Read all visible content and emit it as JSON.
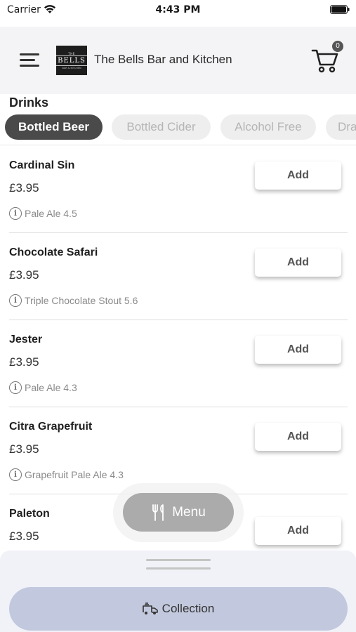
{
  "status_bar": {
    "carrier": "Carrier",
    "time": "4:43 PM"
  },
  "header": {
    "logo": {
      "top": "THE",
      "main": "BELLS",
      "sub": "BAR & KITCHEN"
    },
    "title": "The Bells Bar and Kitchen",
    "cart_count": "0"
  },
  "section": {
    "title": "Drinks"
  },
  "tabs": [
    {
      "label": "Bottled Beer",
      "active": true
    },
    {
      "label": "Bottled Cider",
      "active": false
    },
    {
      "label": "Alcohol Free",
      "active": false
    },
    {
      "label": "Dra",
      "active": false
    }
  ],
  "items": [
    {
      "name": "Cardinal Sin",
      "price": "£3.95",
      "description": "Pale Ale 4.5",
      "add_label": "Add"
    },
    {
      "name": "Chocolate Safari",
      "price": "£3.95",
      "description": "Triple Chocolate Stout 5.6",
      "add_label": "Add"
    },
    {
      "name": "Jester",
      "price": "£3.95",
      "description": "Pale Ale 4.3",
      "add_label": "Add"
    },
    {
      "name": "Citra Grapefruit",
      "price": "£3.95",
      "description": "Grapefruit Pale Ale 4.3",
      "add_label": "Add"
    },
    {
      "name": "Paleton",
      "price": "£3.95",
      "description": "",
      "add_label": "Add"
    }
  ],
  "floating_menu": {
    "label": "Menu"
  },
  "bottom": {
    "collection_label": "Collection"
  },
  "icons": {
    "info": "info-icon",
    "cart": "cart-icon",
    "menu": "fork-knife-icon",
    "collection": "van-icon"
  },
  "colors": {
    "active_tab": "#4a4a4a",
    "menu_button": "#ababab",
    "collection_button": "#c2c8dd"
  }
}
